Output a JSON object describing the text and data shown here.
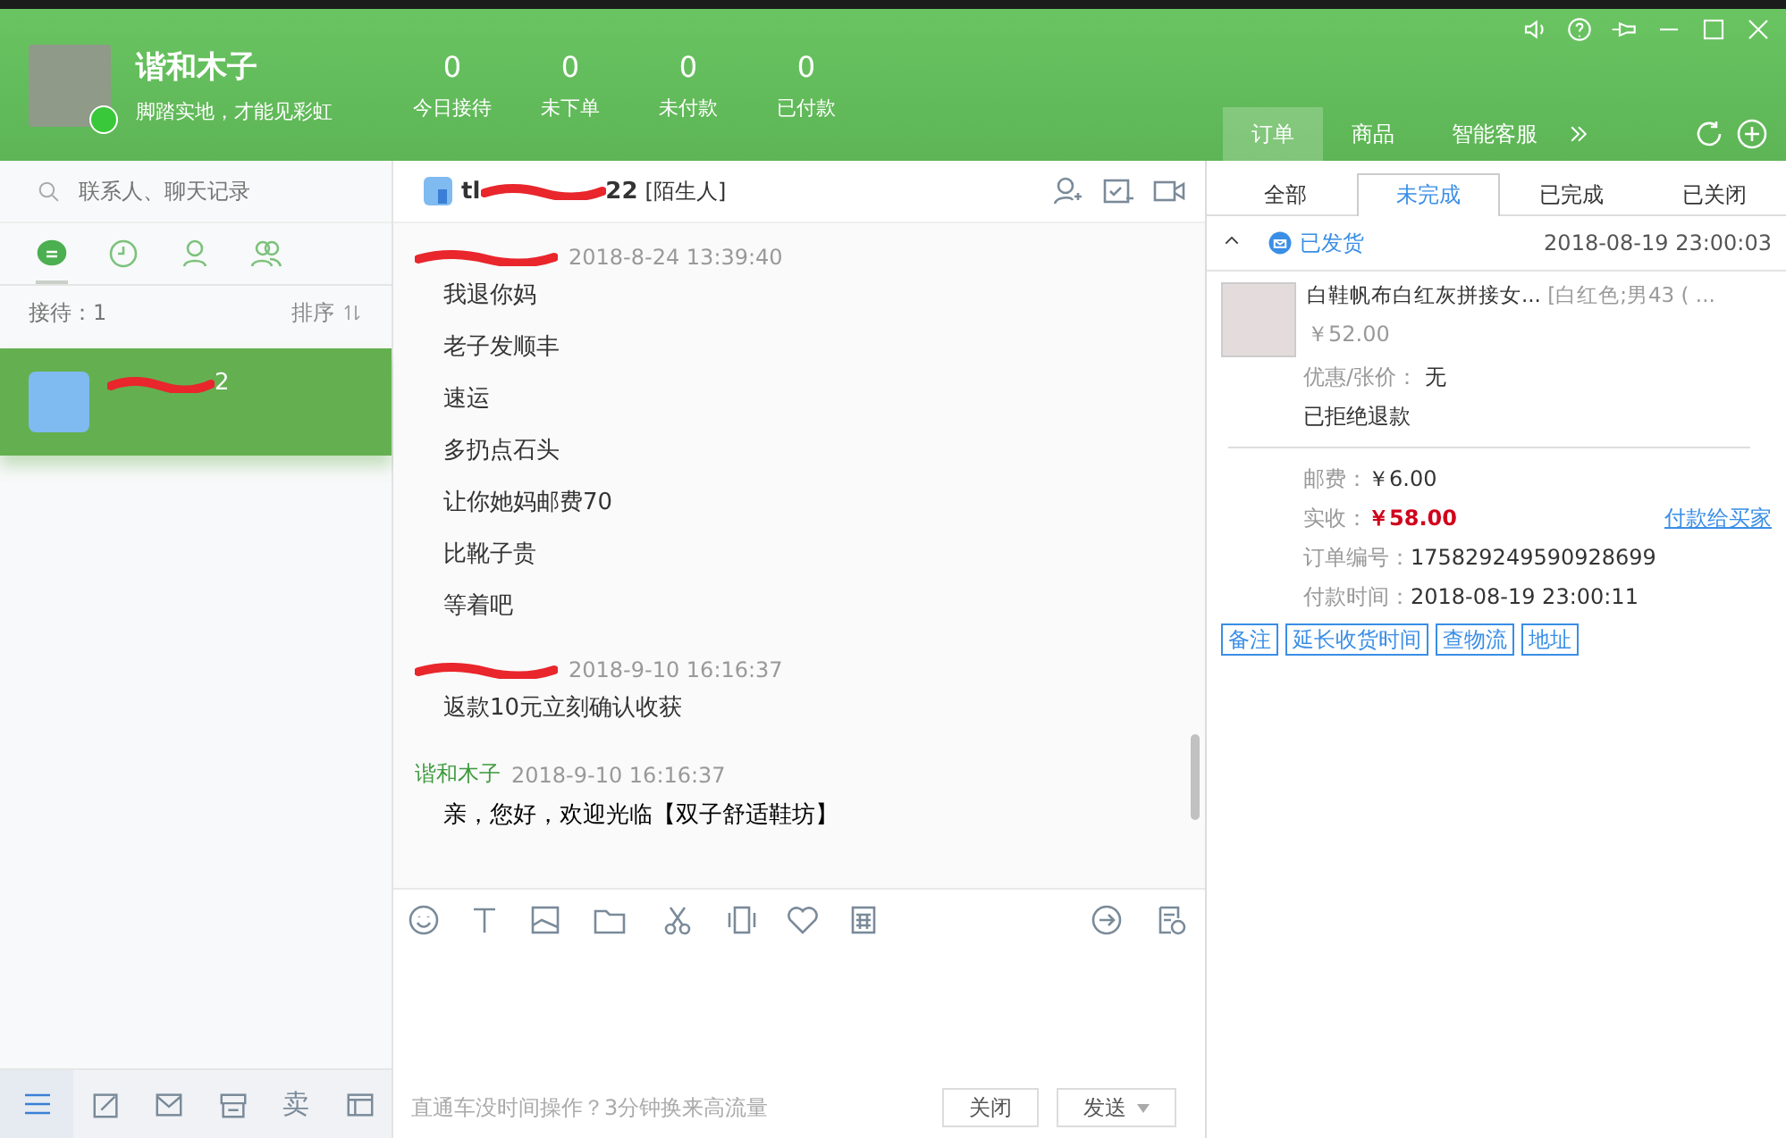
{
  "profile": {
    "name": "谐和木子",
    "motto": "脚踏实地，才能见彩虹",
    "online": true
  },
  "stats": [
    {
      "value": "0",
      "label": "今日接待"
    },
    {
      "value": "0",
      "label": "未下单"
    },
    {
      "value": "0",
      "label": "未付款"
    },
    {
      "value": "0",
      "label": "已付款"
    }
  ],
  "panel_tabs": [
    {
      "label": "订单",
      "selected": true
    },
    {
      "label": "商品",
      "selected": false
    },
    {
      "label": "智能客服",
      "selected": false
    }
  ],
  "search": {
    "placeholder": "联系人、聊天记录"
  },
  "contact_tabs": [
    {
      "kind": "chat",
      "selected": true
    },
    {
      "kind": "recent",
      "selected": false
    },
    {
      "kind": "contact",
      "selected": false
    },
    {
      "kind": "group",
      "selected": false
    }
  ],
  "queue": {
    "label": "接待：1",
    "sort": "排序"
  },
  "contacts": [
    {
      "name_suffix": "2",
      "selected": true
    }
  ],
  "chat_header": {
    "name_prefix": "tl",
    "name_suffix": "22",
    "tag": "[陌生人]"
  },
  "messages": [
    {
      "kind": "buyer",
      "time": "2018-8-24 13:39:40",
      "lines": [
        "我退你妈",
        "老子发顺丰",
        "速运",
        "多扔点石头",
        "让你她妈邮费70",
        "比靴子贵",
        "等着吧"
      ]
    },
    {
      "kind": "buyer",
      "time": "2018-9-10 16:16:37",
      "lines": [
        "返款10元立刻确认收获"
      ]
    },
    {
      "kind": "seller",
      "sender": "谐和木子",
      "time": "2018-9-10 16:16:37",
      "lines": [
        "亲，您好，欢迎光临【双子舒适鞋坊】"
      ]
    }
  ],
  "input": {
    "hint": "直通车没时间操作？3分钟换来高流量",
    "close": "关闭",
    "send": "发送"
  },
  "bottom_tools": [
    {
      "kind": "menu",
      "selected": true
    },
    {
      "kind": "compose",
      "selected": false
    },
    {
      "kind": "mail",
      "selected": false
    },
    {
      "kind": "store",
      "selected": false
    },
    {
      "kind": "text",
      "label": "卖",
      "selected": false
    },
    {
      "kind": "window",
      "selected": false
    }
  ],
  "order_tabs": [
    {
      "label": "全部",
      "selected": false
    },
    {
      "label": "未完成",
      "selected": true
    },
    {
      "label": "已完成",
      "selected": false
    },
    {
      "label": "已关闭",
      "selected": false
    }
  ],
  "order": {
    "expanded": true,
    "status": "已发货",
    "time": "2018-08-19 23:00:03",
    "product_title": "白鞋帆布白红灰拼接女...",
    "product_spec": "[白红色;男43 ( ...",
    "price": "￥52.00",
    "discount_label": "优惠/张价：",
    "discount": "无",
    "refund_status": "已拒绝退款",
    "shipping_label": "邮费：",
    "shipping": "￥6.00",
    "received_label": "实收：",
    "received": "￥58.00",
    "pay_link": "付款给买家",
    "order_no_label": "订单编号：",
    "order_no": "175829249590928699",
    "paid_label": "付款时间：",
    "paid_time": "2018-08-19 23:00:11",
    "actions": [
      "备注",
      "延长收货时间",
      "查物流",
      "地址"
    ]
  }
}
